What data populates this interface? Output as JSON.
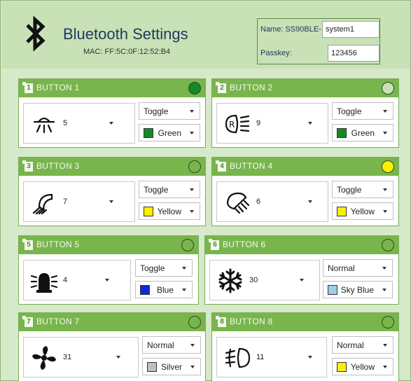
{
  "header": {
    "title": "Bluetooth Settings",
    "mac": "MAC: FF:5C:0F:12:52:B4",
    "name_label": "Name: SS90BLE-",
    "name_value": "system1",
    "passkey_label": "Passkey:",
    "passkey_value": "123456"
  },
  "buttons": [
    {
      "num": "1",
      "title": "BUTTON 1",
      "icon": "dome-light-icon",
      "icon_value": "5",
      "mode": "Toggle",
      "color_name": "Green",
      "swatch": "#138a25",
      "indicator": "#138a25"
    },
    {
      "num": "2",
      "title": "BUTTON 2",
      "icon": "rear-light-icon",
      "icon_value": "9",
      "mode": "Toggle",
      "color_name": "Green",
      "swatch": "#138a25",
      "indicator": "#c9e1b6"
    },
    {
      "num": "3",
      "title": "BUTTON 3",
      "icon": "spot-light-icon",
      "icon_value": "7",
      "mode": "Toggle",
      "color_name": "Yellow",
      "swatch": "#ffef00",
      "indicator": "#79b54d"
    },
    {
      "num": "4",
      "title": "BUTTON 4",
      "icon": "spot-light-icon",
      "icon_value": "6",
      "mode": "Toggle",
      "color_name": "Yellow",
      "swatch": "#ffef00",
      "indicator": "#ffef00"
    },
    {
      "num": "5",
      "title": "BUTTON 5",
      "icon": "beacon-icon",
      "icon_value": "4",
      "mode": "Toggle",
      "color_name": "Blue",
      "swatch": "#1028d8",
      "indicator": "#79b54d"
    },
    {
      "num": "6",
      "title": "BUTTON 6",
      "icon": "snowflake-icon",
      "icon_value": "30",
      "mode": "Normal",
      "color_name": "Sky Blue",
      "swatch": "#9ccfe6",
      "indicator": "#79b54d"
    },
    {
      "num": "7",
      "title": "BUTTON 7",
      "icon": "fan-icon",
      "icon_value": "31",
      "mode": "Normal",
      "color_name": "Silver",
      "swatch": "#c0c0c0",
      "indicator": "#79b54d"
    },
    {
      "num": "8",
      "title": "BUTTON 8",
      "icon": "fog-light-icon",
      "icon_value": "11",
      "mode": "Normal",
      "color_name": "Yellow",
      "swatch": "#ffef00",
      "indicator": "#79b54d"
    }
  ]
}
